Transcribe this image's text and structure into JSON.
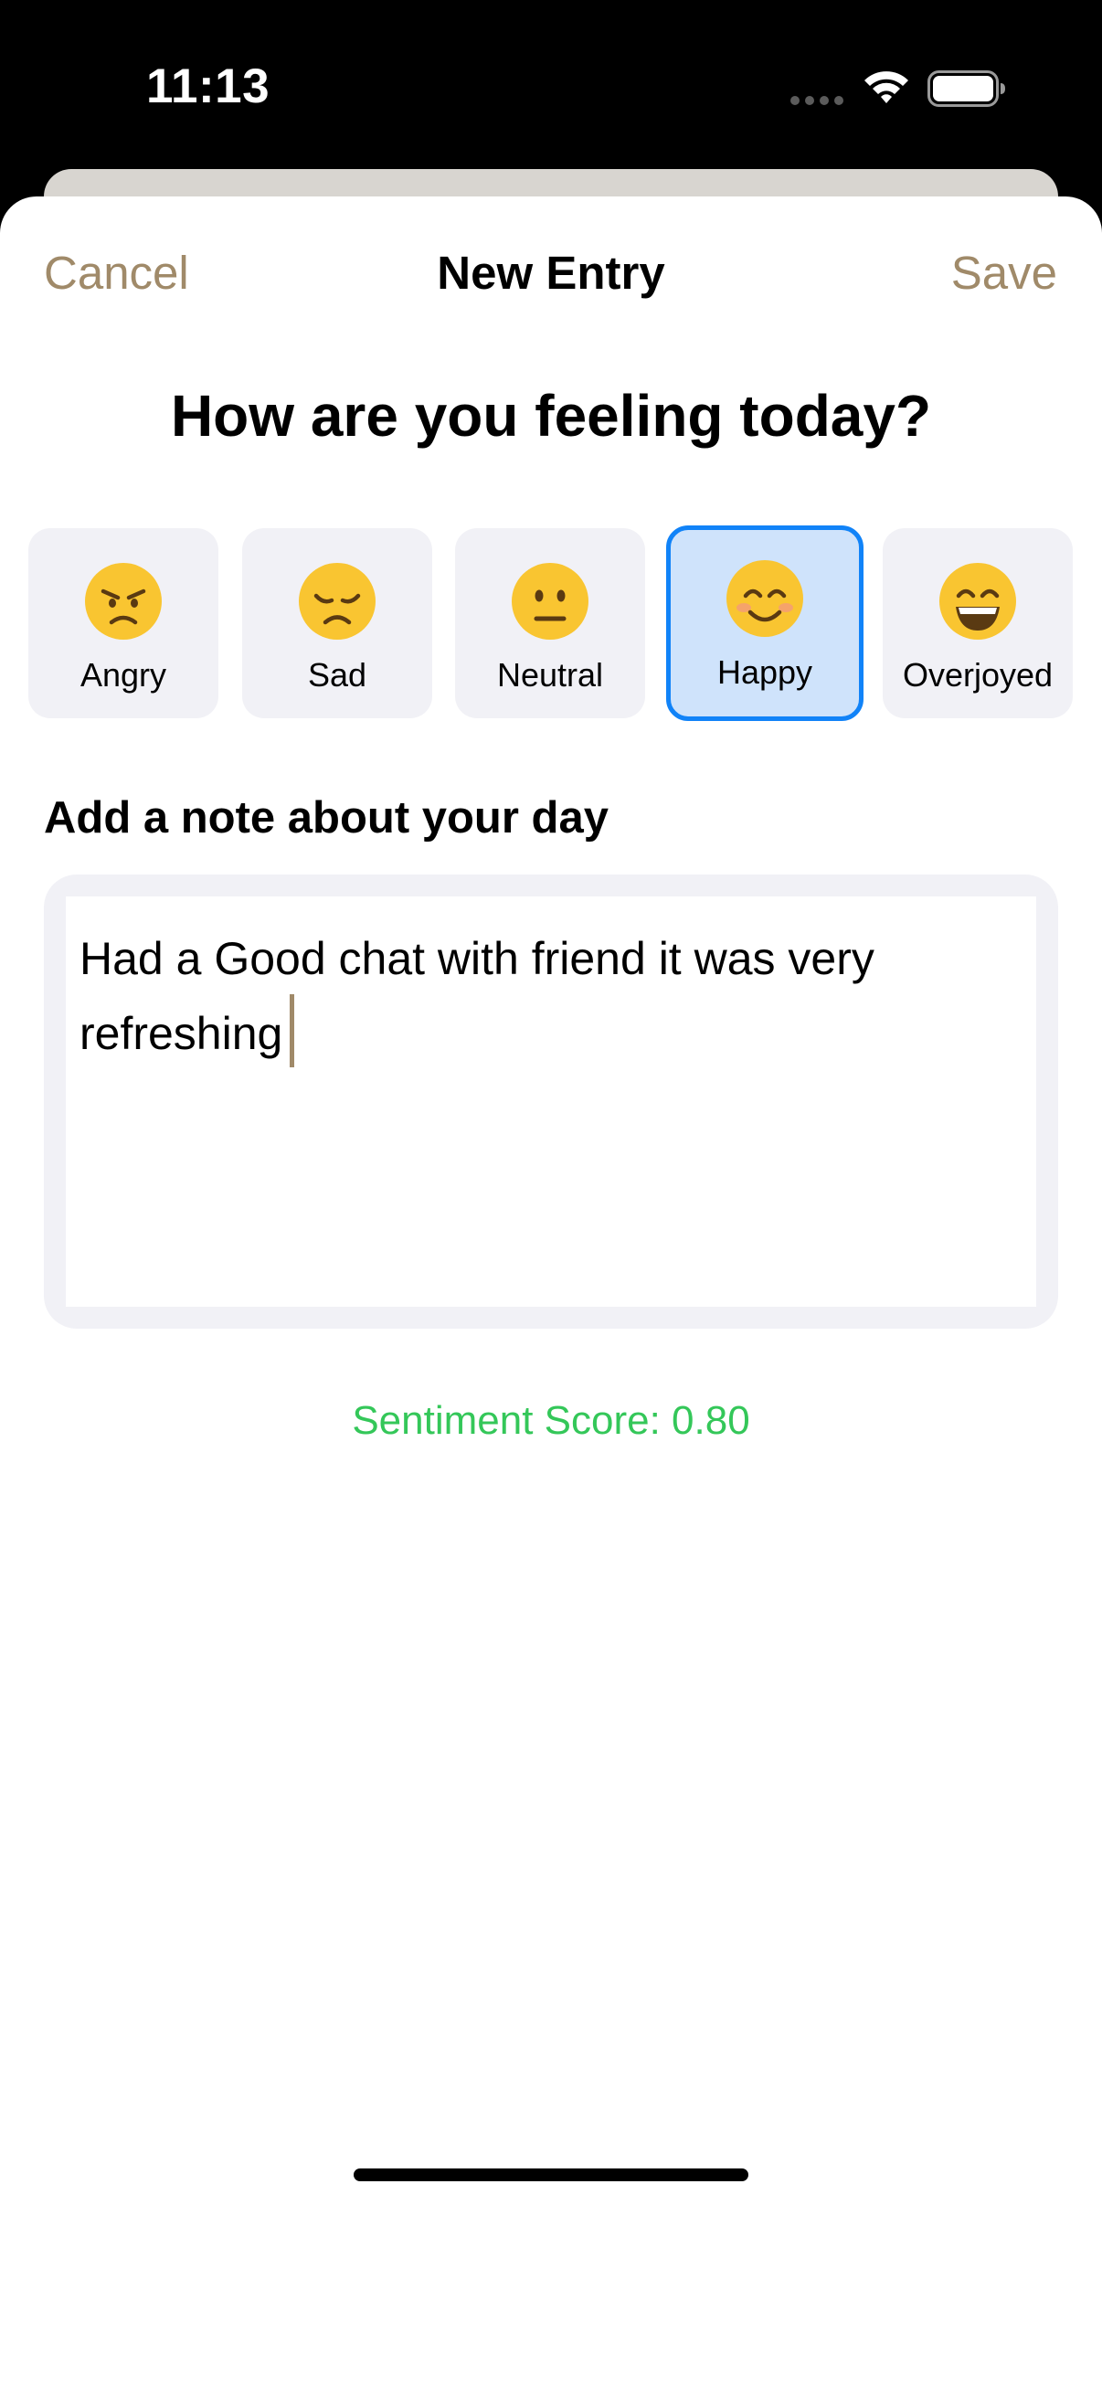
{
  "status_bar": {
    "time": "11:13",
    "icons": [
      "signal-dots-icon",
      "wifi-icon",
      "battery-icon"
    ]
  },
  "nav": {
    "cancel_label": "Cancel",
    "title": "New Entry",
    "save_label": "Save",
    "accent_color": "#a08a69"
  },
  "prompt": "How are you feeling today?",
  "moods": [
    {
      "label": "Angry",
      "icon": "angry-face-icon",
      "selected": false
    },
    {
      "label": "Sad",
      "icon": "sad-face-icon",
      "selected": false
    },
    {
      "label": "Neutral",
      "icon": "neutral-face-icon",
      "selected": false
    },
    {
      "label": "Happy",
      "icon": "smiling-face-icon",
      "selected": true
    },
    {
      "label": "Overjoyed",
      "icon": "grinning-face-icon",
      "selected": false
    }
  ],
  "selection_color": "#1183f8",
  "note": {
    "label": "Add a note about your day",
    "text": "Had a Good chat with friend it was very refreshing"
  },
  "sentiment": {
    "text": "Sentiment Score: 0.80",
    "color": "#34c759"
  }
}
